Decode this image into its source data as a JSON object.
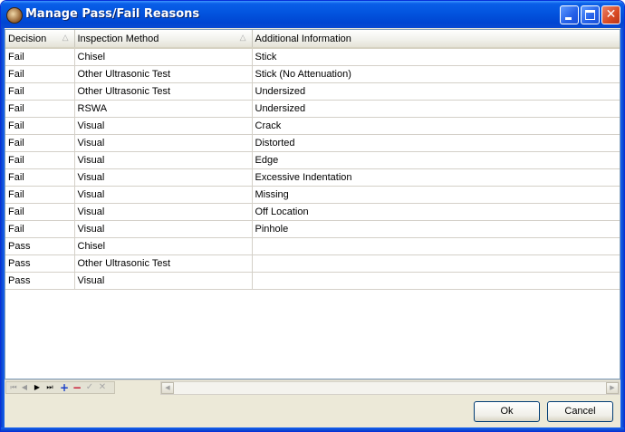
{
  "window": {
    "title": "Manage Pass/Fail Reasons",
    "title_icon": "app-icon",
    "controls": [
      "minimize-icon",
      "maximize-icon",
      "close-icon"
    ]
  },
  "grid": {
    "columns": [
      {
        "label": "Decision",
        "sortable": true
      },
      {
        "label": "Inspection Method",
        "sortable": true
      },
      {
        "label": "Additional Information",
        "sortable": false
      }
    ],
    "rows": [
      {
        "decision": "Fail",
        "method": "Chisel",
        "info": "Stick"
      },
      {
        "decision": "Fail",
        "method": "Other Ultrasonic Test",
        "info": "Stick (No Attenuation)"
      },
      {
        "decision": "Fail",
        "method": "Other Ultrasonic Test",
        "info": "Undersized"
      },
      {
        "decision": "Fail",
        "method": "RSWA",
        "info": "Undersized"
      },
      {
        "decision": "Fail",
        "method": "Visual",
        "info": "Crack"
      },
      {
        "decision": "Fail",
        "method": "Visual",
        "info": "Distorted"
      },
      {
        "decision": "Fail",
        "method": "Visual",
        "info": "Edge"
      },
      {
        "decision": "Fail",
        "method": "Visual",
        "info": "Excessive Indentation"
      },
      {
        "decision": "Fail",
        "method": "Visual",
        "info": "Missing"
      },
      {
        "decision": "Fail",
        "method": "Visual",
        "info": "Off Location"
      },
      {
        "decision": "Fail",
        "method": "Visual",
        "info": "Pinhole"
      },
      {
        "decision": "Pass",
        "method": "Chisel",
        "info": ""
      },
      {
        "decision": "Pass",
        "method": "Other Ultrasonic Test",
        "info": ""
      },
      {
        "decision": "Pass",
        "method": "Visual",
        "info": ""
      }
    ]
  },
  "navigator": {
    "icons": [
      "first-record-icon",
      "previous-record-icon",
      "next-record-icon",
      "last-record-icon",
      "add-record-icon",
      "delete-record-icon",
      "post-edit-icon",
      "cancel-edit-icon"
    ]
  },
  "buttons": {
    "ok": "Ok",
    "cancel": "Cancel"
  }
}
